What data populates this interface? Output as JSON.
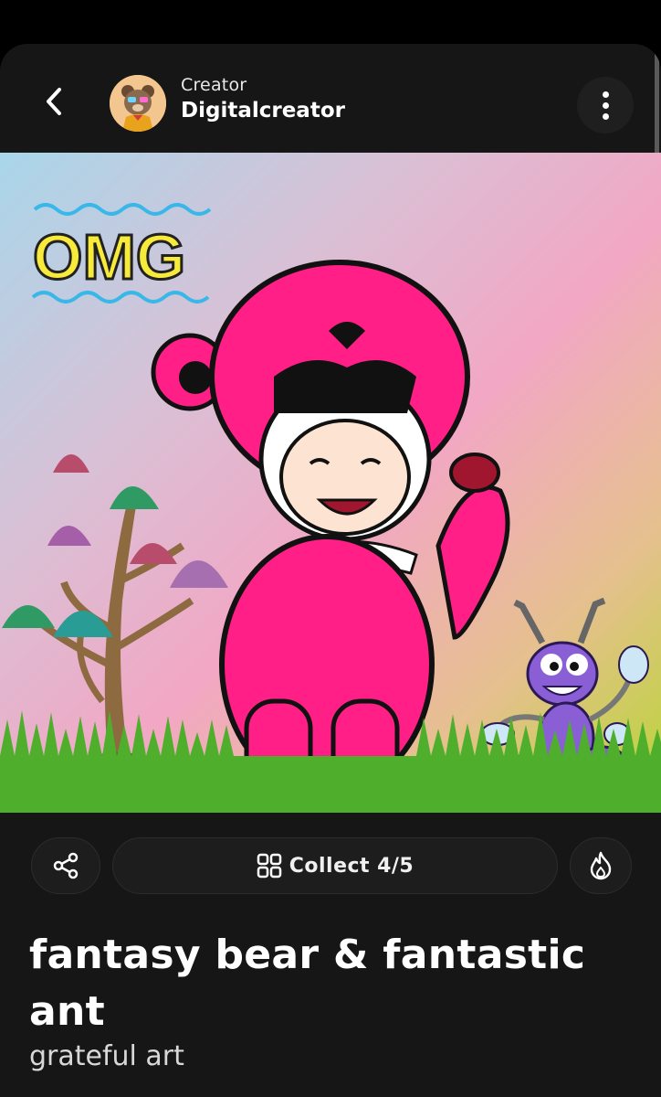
{
  "header": {
    "creator_caption": "Creator",
    "creator_name": "Digitalcreator",
    "back_icon": "chevron-left-icon",
    "more_icon": "vertical-dots-icon"
  },
  "artwork": {
    "badge_text": "OMG",
    "colors": {
      "bear_pink": "#ff1f86",
      "ant_purple": "#8a5fd6",
      "grass_green": "#4fae2b"
    }
  },
  "actions": {
    "share_icon": "share-icon",
    "collect_label": "Collect",
    "collect_count": "4/5",
    "collect_icon": "grid-icon",
    "fire_icon": "fire-icon"
  },
  "post": {
    "title": "fantasy bear & fantastic ant",
    "subtitle": "grateful art"
  }
}
